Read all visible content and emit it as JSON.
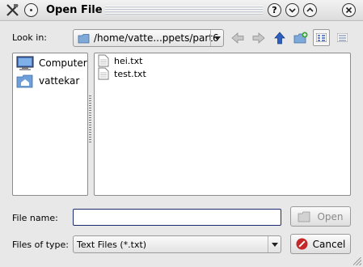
{
  "window": {
    "title": "Open File",
    "buttons": [
      "help",
      "minimize",
      "maximize",
      "close"
    ]
  },
  "toolbar": {
    "look_in_label": "Look in:",
    "look_in_path": "/home/vatte...ppets/part6",
    "tools": [
      "back-icon",
      "forward-icon",
      "parent-directory-icon",
      "new-folder-icon",
      "list-view-icon",
      "detail-view-icon"
    ]
  },
  "places": [
    {
      "label": "Computer",
      "icon": "computer-icon"
    },
    {
      "label": "vattekar",
      "icon": "home-folder-icon"
    }
  ],
  "files": [
    {
      "name": "hei.txt",
      "icon": "text-file-icon"
    },
    {
      "name": "test.txt",
      "icon": "text-file-icon"
    }
  ],
  "form": {
    "file_name_label": "File name:",
    "file_name_value": "",
    "files_of_type_label": "Files of type:",
    "files_of_type_value": "Text Files (*.txt)",
    "open_label": "Open",
    "cancel_label": "Cancel"
  },
  "colors": {
    "accent_arrow": "#2d5fbf",
    "focus_border": "#1a2a6e",
    "cancel_red": "#c62828"
  }
}
